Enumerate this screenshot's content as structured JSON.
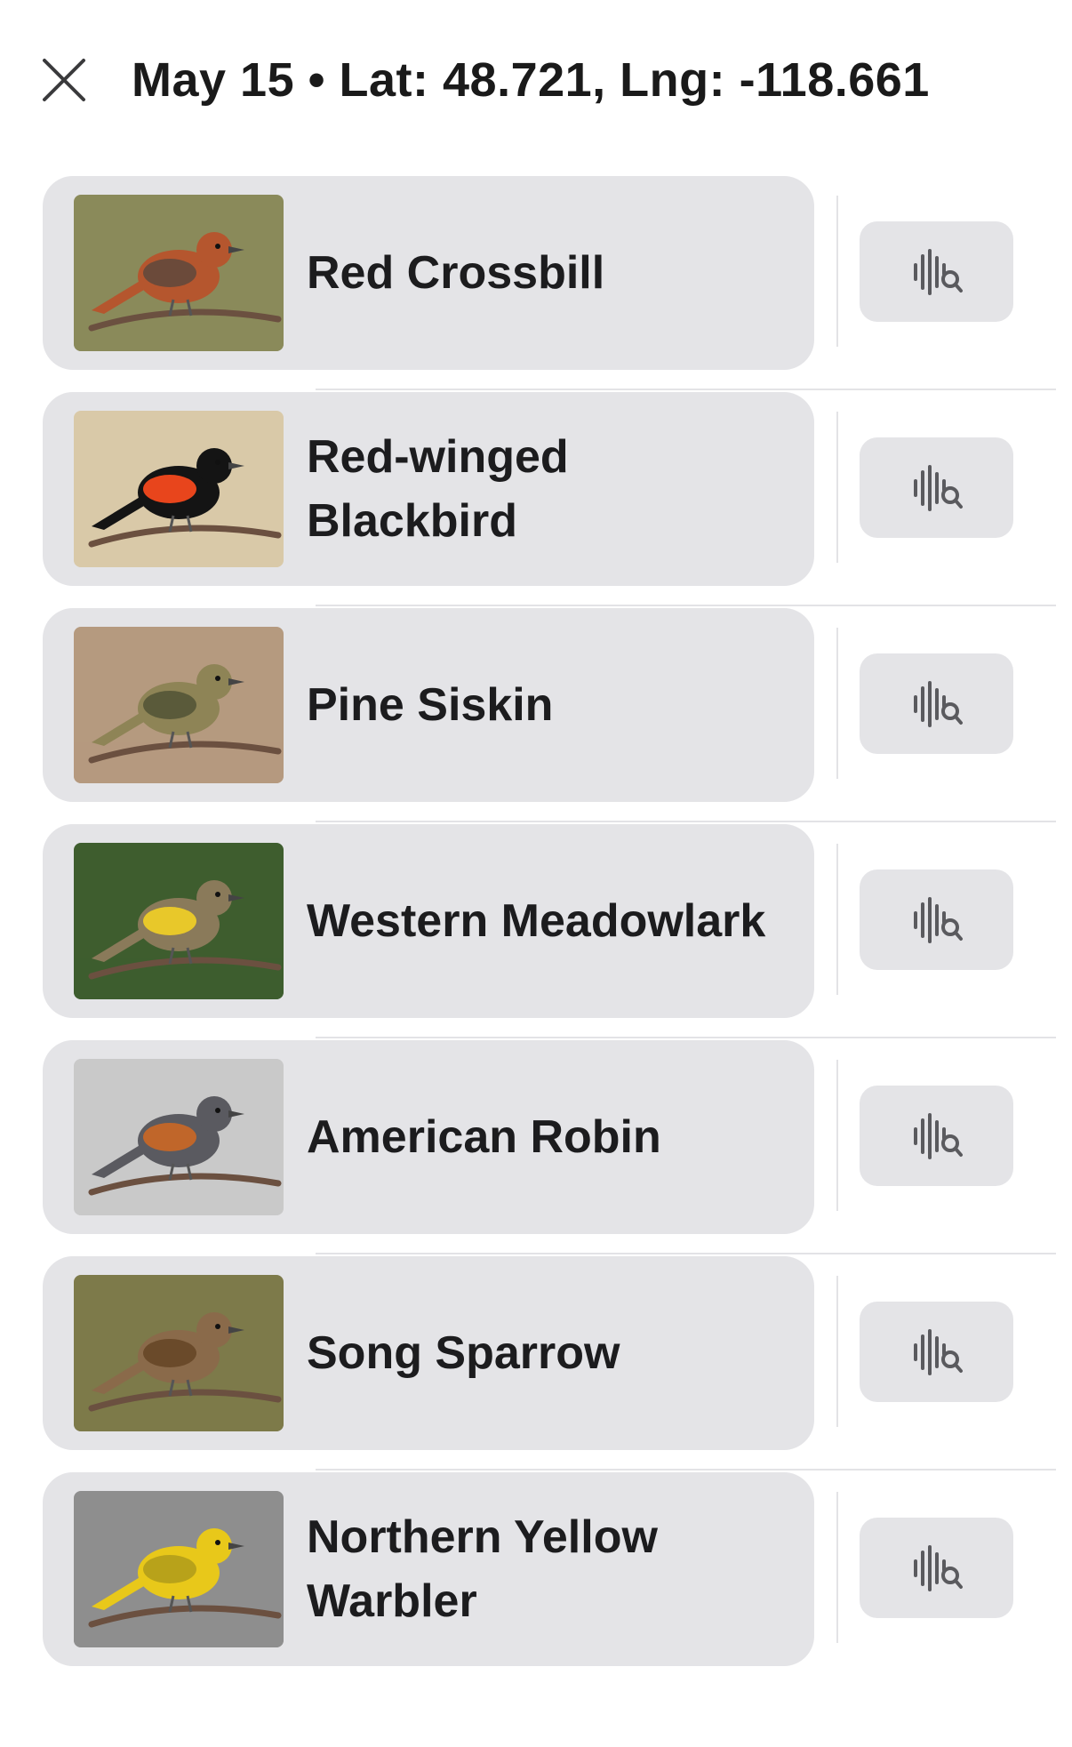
{
  "header": {
    "close_icon": "close-icon",
    "title": "May 15 • Lat: 48.721, Lng: -118.661"
  },
  "birds": [
    {
      "name": "Red Crossbill",
      "photo_colors": {
        "bg": "#8a8a5a",
        "bird": "#b5562e",
        "wing": "#6b4a3a"
      }
    },
    {
      "name": "Red-winged Blackbird",
      "photo_colors": {
        "bg": "#d9c9a8",
        "bird": "#141414",
        "wing": "#e8451c"
      }
    },
    {
      "name": "Pine Siskin",
      "photo_colors": {
        "bg": "#b59a7f",
        "bird": "#8e8456",
        "wing": "#5a5a3a"
      }
    },
    {
      "name": "Western Meadowlark",
      "photo_colors": {
        "bg": "#3e5d2e",
        "bird": "#8a7a5a",
        "wing": "#e8c82a"
      }
    },
    {
      "name": "American Robin",
      "photo_colors": {
        "bg": "#c9c9c9",
        "bird": "#5a5a60",
        "wing": "#c0662a"
      }
    },
    {
      "name": "Song Sparrow",
      "photo_colors": {
        "bg": "#7d7a4a",
        "bird": "#8a6a4a",
        "wing": "#6a4a2a"
      }
    },
    {
      "name": "Northern Yellow Warbler",
      "photo_colors": {
        "bg": "#8e8e8e",
        "bird": "#e8c81a",
        "wing": "#b8a21a"
      }
    }
  ],
  "sound_button_icon": "sound-search-icon"
}
